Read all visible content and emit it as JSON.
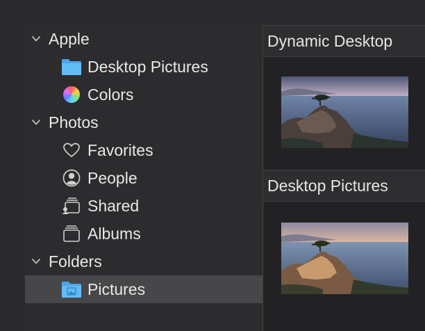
{
  "sidebar": {
    "groups": {
      "apple": "Apple",
      "photos": "Photos",
      "folders": "Folders"
    },
    "items": {
      "desktop_pictures": "Desktop Pictures",
      "colors": "Colors",
      "favorites": "Favorites",
      "people": "People",
      "shared": "Shared",
      "albums": "Albums",
      "pictures": "Pictures"
    },
    "selected": "Pictures"
  },
  "content": {
    "sections": [
      {
        "title": "Dynamic Desktop"
      },
      {
        "title": "Desktop Pictures"
      }
    ]
  },
  "colors": {
    "folder_blue": "#5bb8f5",
    "selection": "#474749"
  }
}
